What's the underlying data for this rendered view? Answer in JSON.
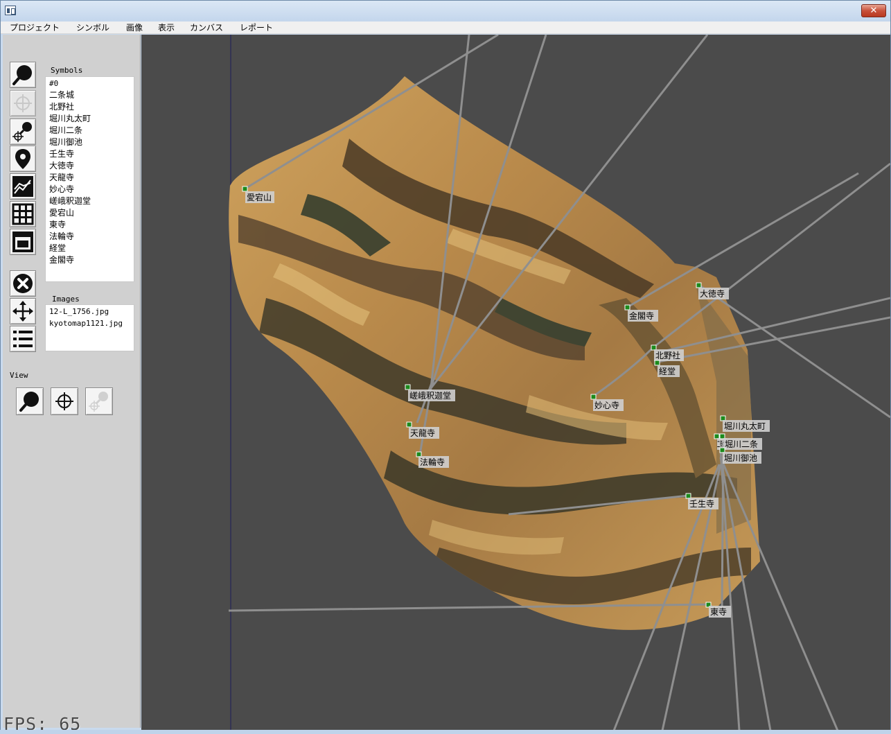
{
  "window": {
    "title": "",
    "close_label": "✕"
  },
  "menu": [
    "プロジェクト",
    "シンボル",
    "画像",
    "表示",
    "カンバス",
    "レポート"
  ],
  "sidebar": {
    "tools": [
      {
        "name": "zoom-tool",
        "icon": "magnifier-icon"
      },
      {
        "name": "target-tool",
        "icon": "crosshair-icon",
        "active": true
      },
      {
        "name": "zoom-target-tool",
        "icon": "magnifier-crosshair-icon"
      },
      {
        "name": "place-pin-tool",
        "icon": "map-pin-icon"
      },
      {
        "name": "chart-tool",
        "icon": "line-chart-icon"
      },
      {
        "name": "grid-tool",
        "icon": "grid-icon"
      },
      {
        "name": "layout-tool",
        "icon": "window-layout-icon"
      },
      {
        "name": "delete-tool",
        "icon": "close-circle-icon"
      },
      {
        "name": "move-tool",
        "icon": "move-arrows-icon"
      },
      {
        "name": "list-tool",
        "icon": "list-icon"
      }
    ],
    "symbols_header": "Symbols",
    "symbols": [
      "#0",
      "二条城",
      "北野社",
      "堀川丸太町",
      "堀川二条",
      "堀川御池",
      "壬生寺",
      "大徳寺",
      "天龍寺",
      "妙心寺",
      "嵯峨釈迦堂",
      "愛宕山",
      "東寺",
      "法輪寺",
      "経堂",
      "金閣寺"
    ],
    "images_header": "Images",
    "images": [
      "12-L_1756.jpg",
      "kyotomap1121.jpg"
    ],
    "view_label": "View",
    "view_buttons": [
      {
        "name": "view-zoom",
        "icon": "magnifier-icon"
      },
      {
        "name": "view-target",
        "icon": "crosshair-icon"
      },
      {
        "name": "view-zoom-target",
        "icon": "magnifier-crosshair-icon",
        "disabled": true
      }
    ]
  },
  "fps": "FPS: 65",
  "canvas": {
    "background": "#4b4b4b",
    "markers": [
      {
        "label": "愛宕山"
      },
      {
        "label": "大徳寺"
      },
      {
        "label": "金閣寺"
      },
      {
        "label": "北野社"
      },
      {
        "label": "経堂"
      },
      {
        "label": "嵯峨釈迦堂"
      },
      {
        "label": "妙心寺"
      },
      {
        "label": "天龍寺"
      },
      {
        "label": "法輪寺"
      },
      {
        "label": "堀川丸太町"
      },
      {
        "label": "二条城"
      },
      {
        "label": "堀川二条"
      },
      {
        "label": "堀川御池"
      },
      {
        "label": "壬生寺"
      },
      {
        "label": "東寺"
      }
    ]
  }
}
